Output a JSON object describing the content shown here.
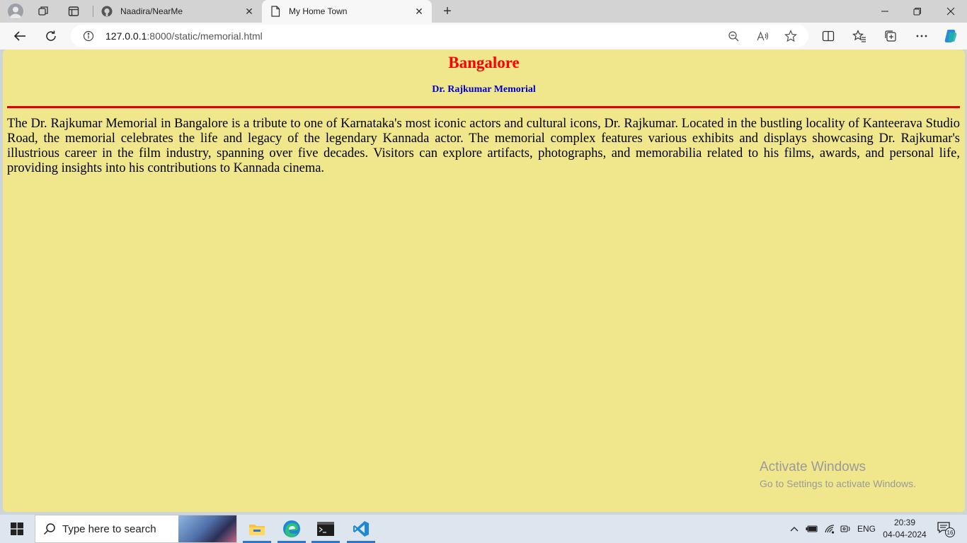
{
  "browser": {
    "tabs": [
      {
        "title": "Naadira/NearMe",
        "icon": "github-icon"
      },
      {
        "title": "My Home Town",
        "icon": "page-icon"
      }
    ],
    "url_host": "127.0.0.1",
    "url_rest": ":8000/static/memorial.html"
  },
  "page": {
    "title": "Bangalore",
    "subtitle": "Dr. Rajkumar Memorial",
    "body": "The Dr. Rajkumar Memorial in Bangalore is a tribute to one of Karnataka's most iconic actors and cultural icons, Dr. Rajkumar. Located in the bustling locality of Kanteerava Studio Road, the memorial celebrates the life and legacy of the legendary Kannada actor. The memorial complex features various exhibits and displays showcasing Dr. Rajkumar's illustrious career in the film industry, spanning over five decades. Visitors can explore artifacts, photographs, and memorabilia related to his films, awards, and personal life, providing insights into his contributions to Kannada cinema.",
    "background_color": "#f0e68c",
    "title_color": "#ff0000",
    "subtitle_color": "#0000cc"
  },
  "watermark": {
    "line1": "Activate Windows",
    "line2": "Go to Settings to activate Windows."
  },
  "taskbar": {
    "search_placeholder": "Type here to search",
    "language": "ENG",
    "time": "20:39",
    "date": "04-04-2024",
    "notification_count": "16"
  }
}
